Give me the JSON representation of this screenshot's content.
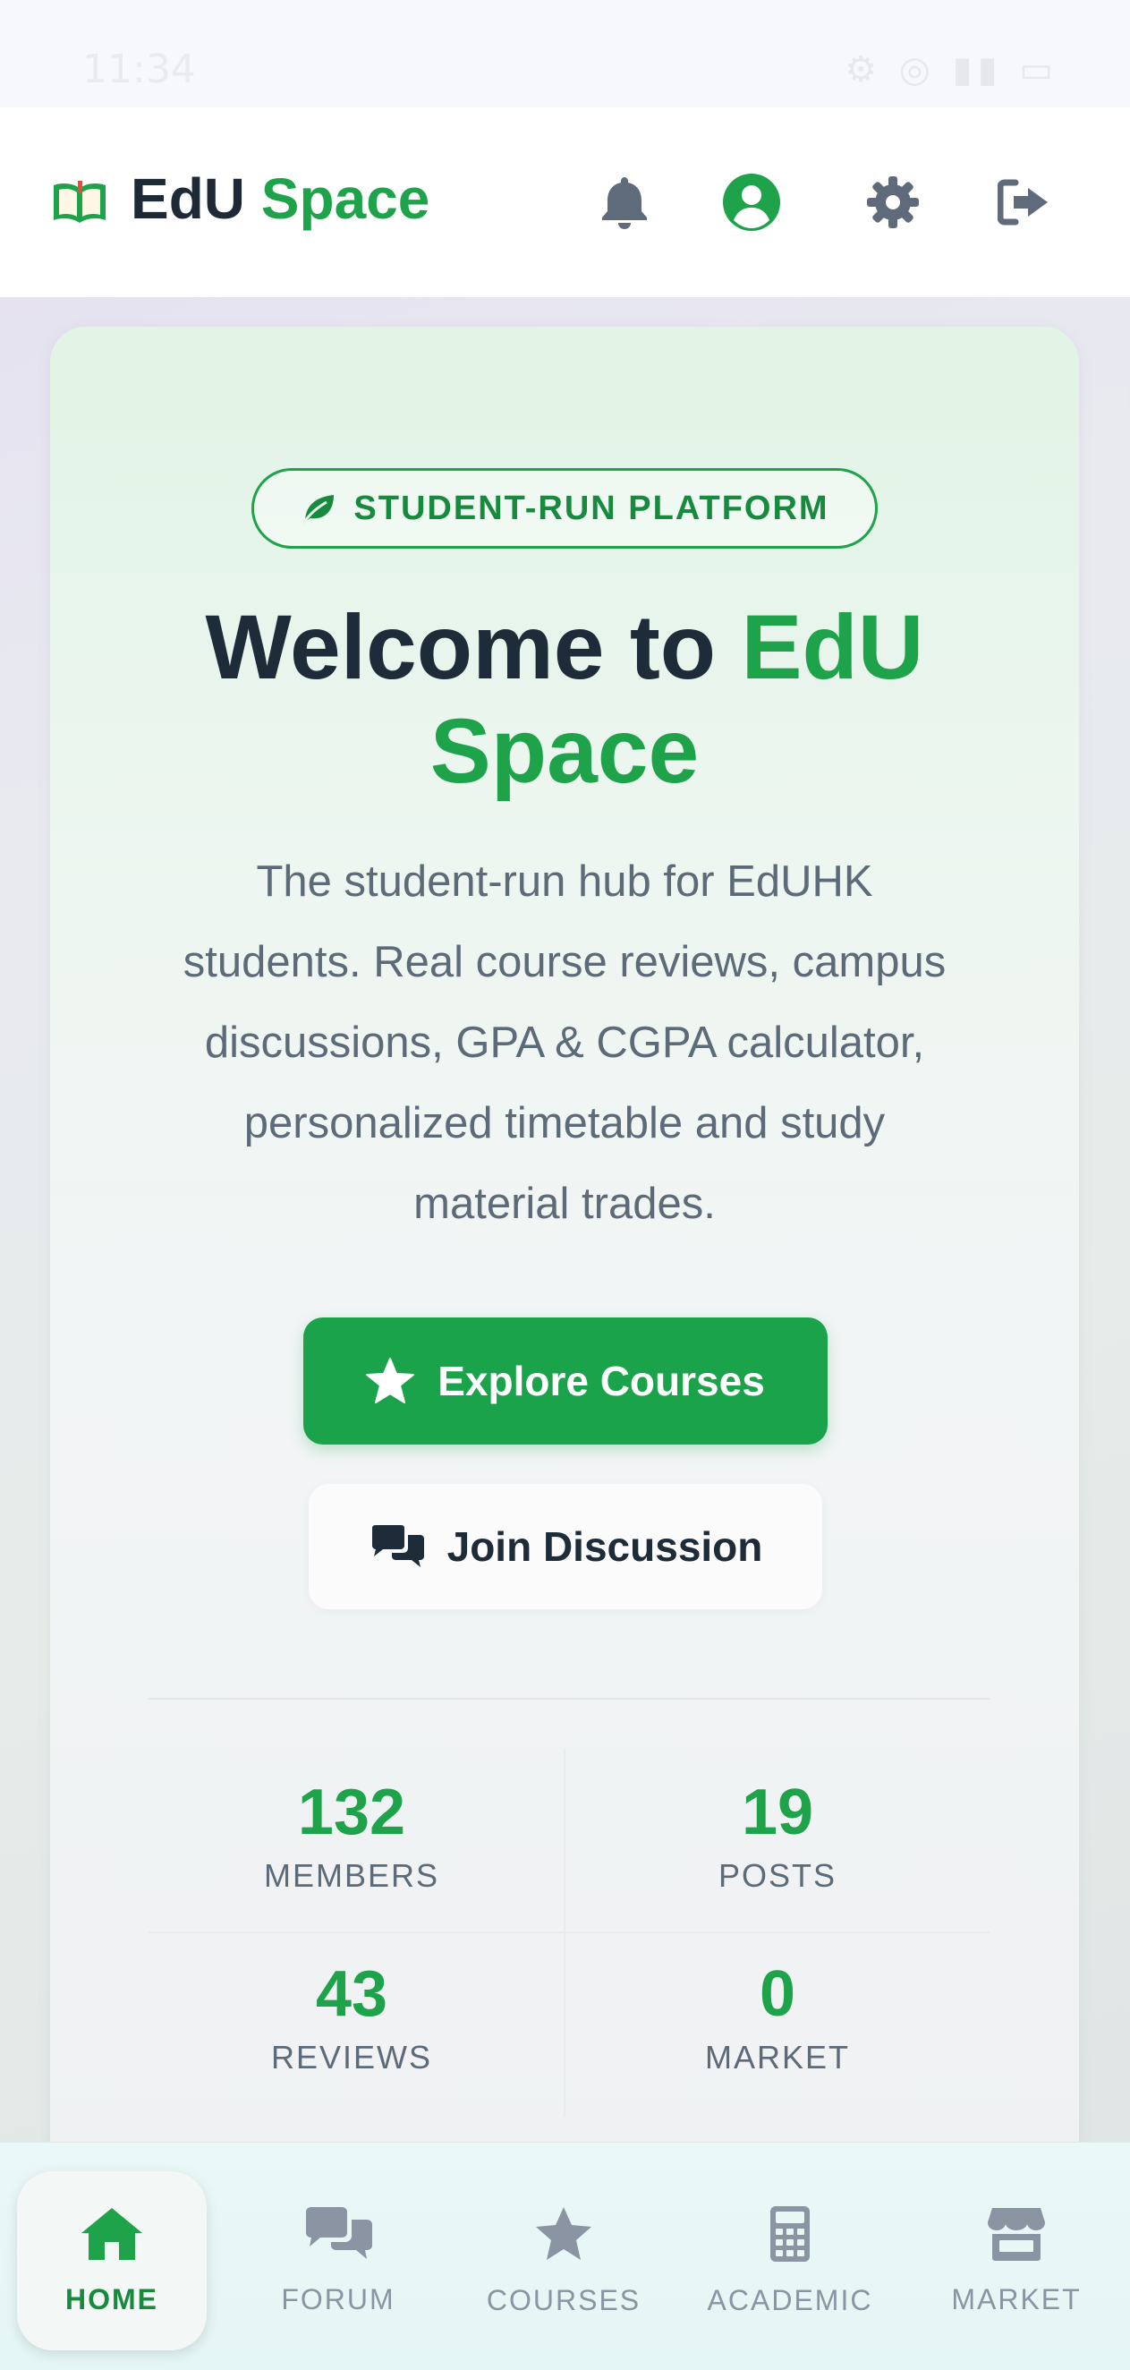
{
  "status_bar": {
    "time": "11:34",
    "icons_text": "⚙ ◎ ▮▮ ▭"
  },
  "header": {
    "logo_primary": "EdU",
    "logo_accent": "Space",
    "icons": [
      "book-icon",
      "bell-icon",
      "user-circle-icon",
      "gear-icon",
      "logout-icon"
    ]
  },
  "hero": {
    "badge": "STUDENT-RUN PLATFORM",
    "title_primary": "Welcome to",
    "title_accent_1": "EdU",
    "title_accent_2": "Space",
    "description": "The student-run hub for EdUHK students. Real course reviews, campus discussions, GPA & CGPA calculator, personalized timetable and study material trades.",
    "primary_button": "Explore Courses",
    "secondary_button": "Join Discussion"
  },
  "stats": [
    {
      "value": "132",
      "label": "MEMBERS"
    },
    {
      "value": "19",
      "label": "POSTS"
    },
    {
      "value": "43",
      "label": "REVIEWS"
    },
    {
      "value": "0",
      "label": "MARKET"
    }
  ],
  "nav": {
    "items": [
      {
        "label": "HOME",
        "icon": "home-icon",
        "active": true
      },
      {
        "label": "FORUM",
        "icon": "comments-icon",
        "active": false
      },
      {
        "label": "COURSES",
        "icon": "star-icon",
        "active": false
      },
      {
        "label": "ACADEMIC",
        "icon": "calculator-icon",
        "active": false
      },
      {
        "label": "MARKET",
        "icon": "store-icon",
        "active": false
      }
    ]
  },
  "colors": {
    "accent": "#1ea34a",
    "text_dark": "#1e2b38",
    "text_muted": "#5d6a78"
  }
}
